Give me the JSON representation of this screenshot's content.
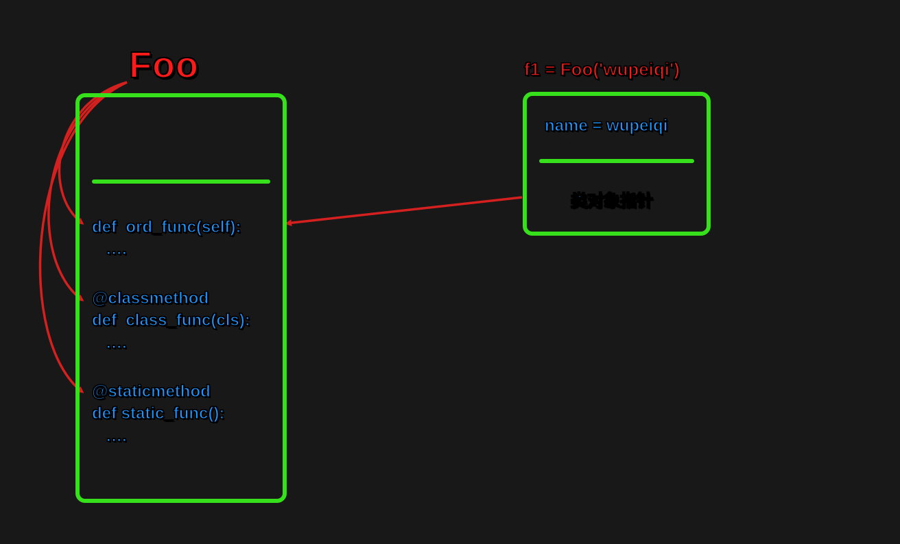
{
  "class_box": {
    "title": "Foo",
    "methods": {
      "ord_func": "def  ord_func(self):\n   ….",
      "class_func": "@classmethod\ndef  class_func(cls):\n   ….",
      "static_func": "@staticmethod\ndef static_func():\n   …."
    }
  },
  "instance_box": {
    "title": "f1 = Foo('wupeiqi')",
    "attribute": "name = wupeiqi",
    "pointer_label": "类对象指针"
  }
}
